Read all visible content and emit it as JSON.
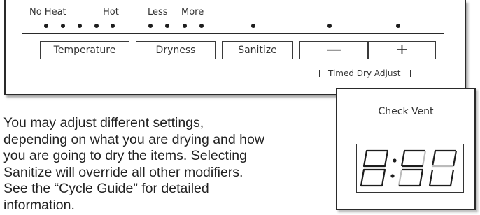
{
  "indicator_labels": {
    "no_heat": "No Heat",
    "hot": "Hot",
    "less": "Less",
    "more": "More"
  },
  "buttons": {
    "temperature": "Temperature",
    "dryness": "Dryness",
    "sanitize": "Sanitize",
    "minus": "—",
    "plus": "+"
  },
  "timed_dry_adjust": "Timed Dry Adjust",
  "description": [
    "You may adjust different settings,",
    "depending on what you are drying and how",
    "you are going to dry the items. Selecting",
    "Sanitize will override all other modifiers.",
    "See the “Cycle Guide” for detailed",
    "information."
  ],
  "display": {
    "label": "Check Vent",
    "readout": "8:50"
  }
}
